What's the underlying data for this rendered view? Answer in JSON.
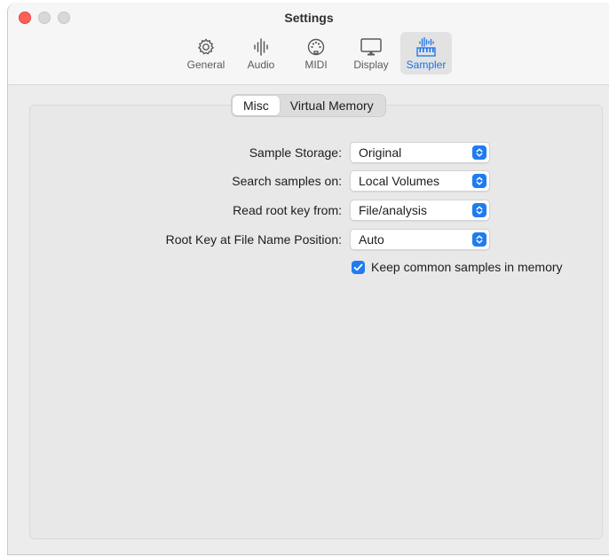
{
  "window": {
    "title": "Settings"
  },
  "toolbar": {
    "tabs": [
      {
        "label": "General",
        "icon": "gear-icon",
        "active": false
      },
      {
        "label": "Audio",
        "icon": "waveform-icon",
        "active": false
      },
      {
        "label": "MIDI",
        "icon": "midi-connector-icon",
        "active": false
      },
      {
        "label": "Display",
        "icon": "monitor-icon",
        "active": false
      },
      {
        "label": "Sampler",
        "icon": "sampler-keyboard-icon",
        "active": true
      }
    ]
  },
  "segment": {
    "tabs": [
      {
        "label": "Misc",
        "active": true
      },
      {
        "label": "Virtual Memory",
        "active": false
      }
    ]
  },
  "settings": {
    "rows": [
      {
        "label": "Sample Storage:",
        "value": "Original"
      },
      {
        "label": "Search samples on:",
        "value": "Local Volumes"
      },
      {
        "label": "Read root key from:",
        "value": "File/analysis"
      },
      {
        "label": "Root Key at File Name Position:",
        "value": "Auto"
      }
    ],
    "keep_common": {
      "label": "Keep common samples in memory",
      "checked": true
    }
  },
  "colors": {
    "accent": "#1f7cf0",
    "close": "#fe5f57",
    "window_bg": "#ececec"
  }
}
